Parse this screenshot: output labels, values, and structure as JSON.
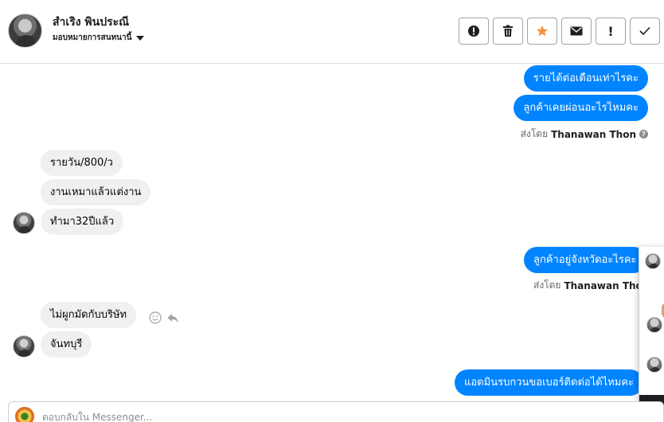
{
  "header": {
    "name": "สำเริง พินประณี",
    "assign_label": "มอบหมายการสนทนานี้",
    "buttons": {
      "spam": "spam-icon",
      "delete": "trash-icon",
      "star": "star-icon",
      "unread": "envelope-icon",
      "important_label": "!",
      "done": "check-icon"
    }
  },
  "messages": [
    {
      "id": "m1",
      "direction": "out",
      "text": "รายได้ต่อเดือนเท่าไรคะ"
    },
    {
      "id": "m2",
      "direction": "out",
      "text": "ลูกค้าเคยผ่อนอะไรไหมคะ"
    },
    {
      "id": "s1",
      "sent_by_prefix": "ส่งโดย",
      "sent_by_name": "Thanawan Thon"
    },
    {
      "id": "m3",
      "direction": "in",
      "text": "รายวัน/800/ว"
    },
    {
      "id": "m4",
      "direction": "in",
      "text": "งานเหมาแล้วแต่งาน"
    },
    {
      "id": "m5",
      "direction": "in",
      "text": "ทำมา32ปีแล้ว"
    },
    {
      "id": "m6",
      "direction": "out",
      "text": "ลูกค้าอยู่จังหวัดอะไรคะ"
    },
    {
      "id": "s2",
      "sent_by_prefix": "ส่งโดย",
      "sent_by_name": "Thanawan Thon"
    },
    {
      "id": "m7",
      "direction": "in",
      "text": "ไม่ผูกมัดกับบริษัท"
    },
    {
      "id": "m8",
      "direction": "in",
      "text": "จันทบุรี"
    },
    {
      "id": "m9",
      "direction": "out",
      "text": "แอดมินรบกวนขอเบอร์ติดต่อได้ไหมคะ"
    }
  ],
  "composer": {
    "placeholder": "ตอบกลับใน Messenger..."
  },
  "colors": {
    "outgoing_bubble": "#0084ff",
    "incoming_bubble": "#f0f0f0",
    "star": "#f7923a"
  }
}
